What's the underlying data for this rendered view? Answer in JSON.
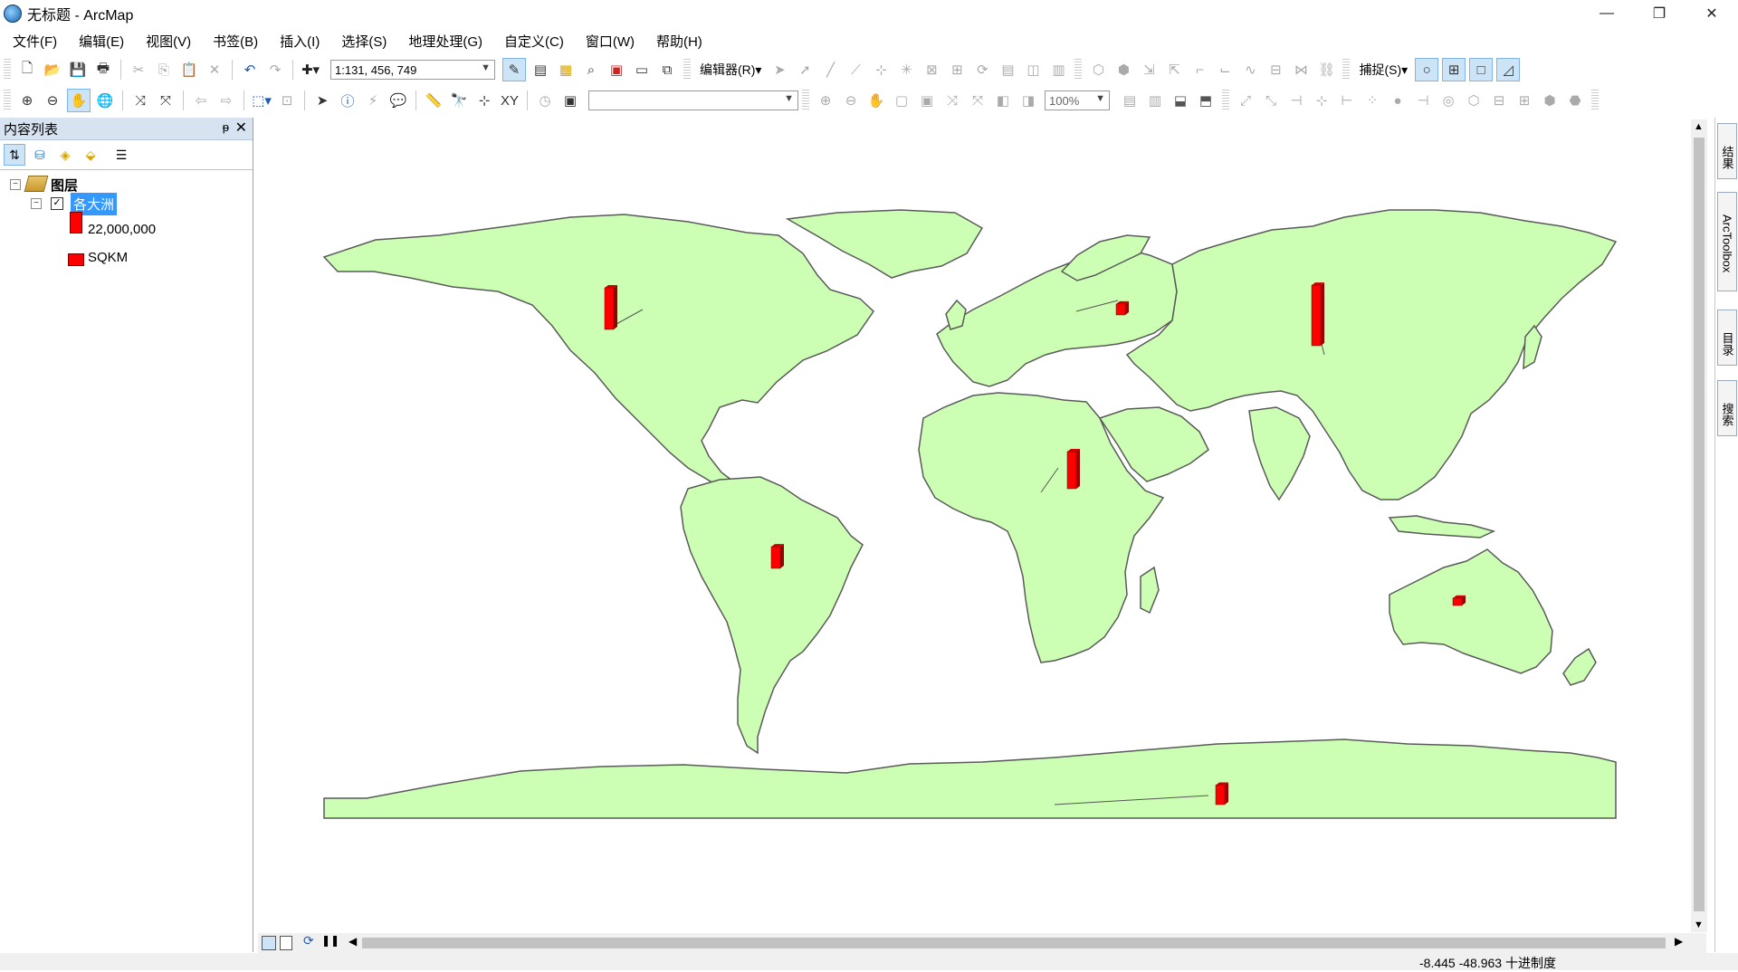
{
  "window": {
    "title": "无标题 - ArcMap",
    "minimize": "—",
    "maximize": "❐",
    "close": "✕"
  },
  "menu": [
    "文件(F)",
    "编辑(E)",
    "视图(V)",
    "书签(B)",
    "插入(I)",
    "选择(S)",
    "地理处理(G)",
    "自定义(C)",
    "窗口(W)",
    "帮助(H)"
  ],
  "toolbar": {
    "scale": "1:131, 456, 749",
    "editor_label": "编辑器(R)▾",
    "snapping_label": "捕捉(S)▾",
    "zoom_percent": "100%",
    "layer_combo": ""
  },
  "toc": {
    "title": "内容列表",
    "pin": "ᵽ",
    "close": "✕",
    "root_label": "图层",
    "layer_label": "各大洲",
    "legend_value": "22,000,000",
    "legend_field": "SQKM",
    "layer_checked": true
  },
  "dock_tabs": [
    "结果",
    "ArcToolbox",
    "目录",
    "搜索"
  ],
  "status": {
    "coords": "-8.445  -48.963 十进制度"
  },
  "colors": {
    "land": "#ccffb3",
    "coast": "#5a5a5a",
    "bar": "#ff0000",
    "selection": "#3399ff"
  },
  "chart_data": {
    "type": "bar",
    "title": "",
    "legend_value": 22000000,
    "legend_field": "SQKM",
    "categories": [
      "North America",
      "Europe",
      "Asia",
      "Africa",
      "South America",
      "Oceania",
      "Antarctica"
    ],
    "values": [
      22000000,
      5800000,
      32000000,
      19600000,
      11400000,
      3900000,
      10300000
    ]
  }
}
